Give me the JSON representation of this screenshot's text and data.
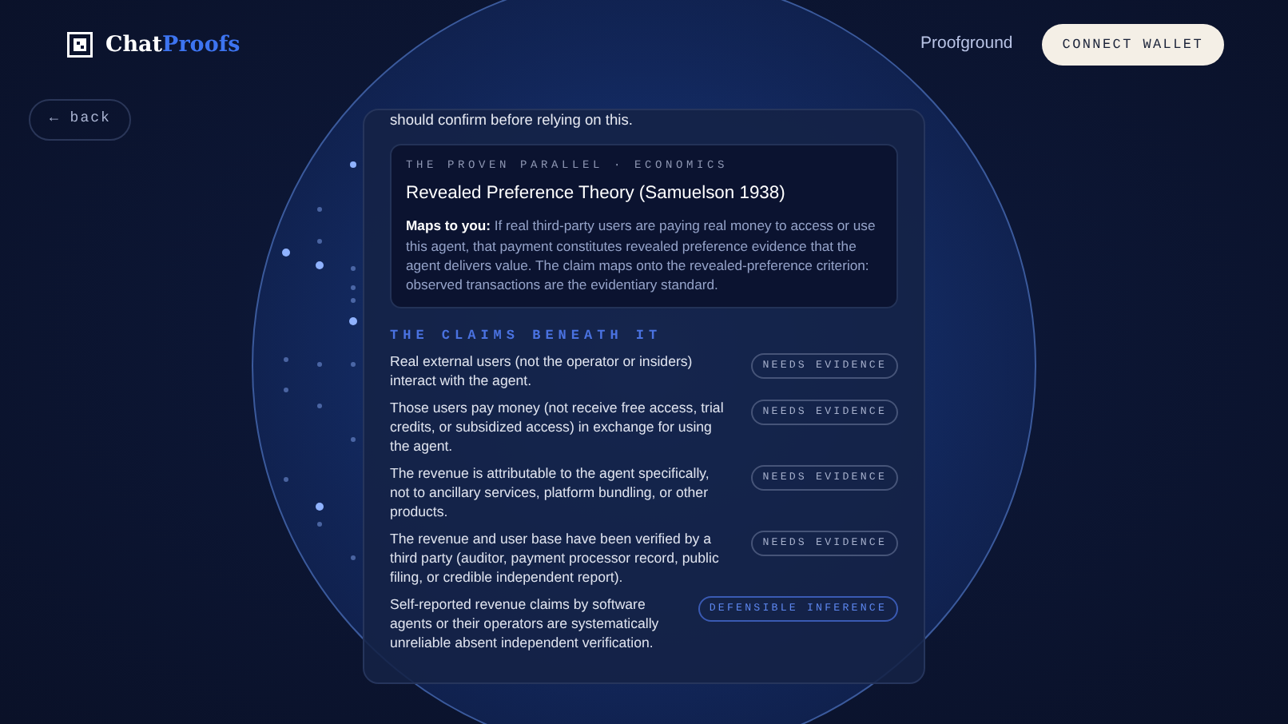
{
  "header": {
    "brand": {
      "part_1": "Chat",
      "part_2": "Proofs"
    },
    "nav_link": "Proofground",
    "connect_button": "CONNECT WALLET"
  },
  "back_button": "← back",
  "card": {
    "lead_text": "should confirm before relying on this.",
    "parallel": {
      "eyebrow": "THE PROVEN PARALLEL · ECONOMICS",
      "title": "Revealed Preference Theory (Samuelson 1938)",
      "body": "**Maps to you:** If real third-party users are paying real money to access or use this agent, that payment constitutes revealed preference evidence that the agent delivers value. The claim maps onto the revealed-preference criterion: observed transactions are the evidentiary standard."
    },
    "claims_heading": "THE CLAIMS BENEATH IT",
    "claims": [
      {
        "text": "Real external users (not the operator or insiders) interact with the agent.",
        "status": "NEEDS EVIDENCE",
        "kind": "needs_evidence"
      },
      {
        "text": "Those users pay money (not receive free access, trial credits, or subsidized access) in exchange for using the agent.",
        "status": "NEEDS EVIDENCE",
        "kind": "needs_evidence"
      },
      {
        "text": "The revenue is attributable to the agent specifically, not to ancillary services, platform bundling, or other products.",
        "status": "NEEDS EVIDENCE",
        "kind": "needs_evidence"
      },
      {
        "text": "The revenue and user base have been verified by a third party (auditor, payment processor record, public filing, or credible independent report).",
        "status": "NEEDS EVIDENCE",
        "kind": "needs_evidence"
      },
      {
        "text": "Self-reported revenue claims by software agents or their operators are systematically unreliable absent independent verification.",
        "status": "DEFENSIBLE INFERENCE",
        "kind": "defensible_inference"
      }
    ]
  }
}
